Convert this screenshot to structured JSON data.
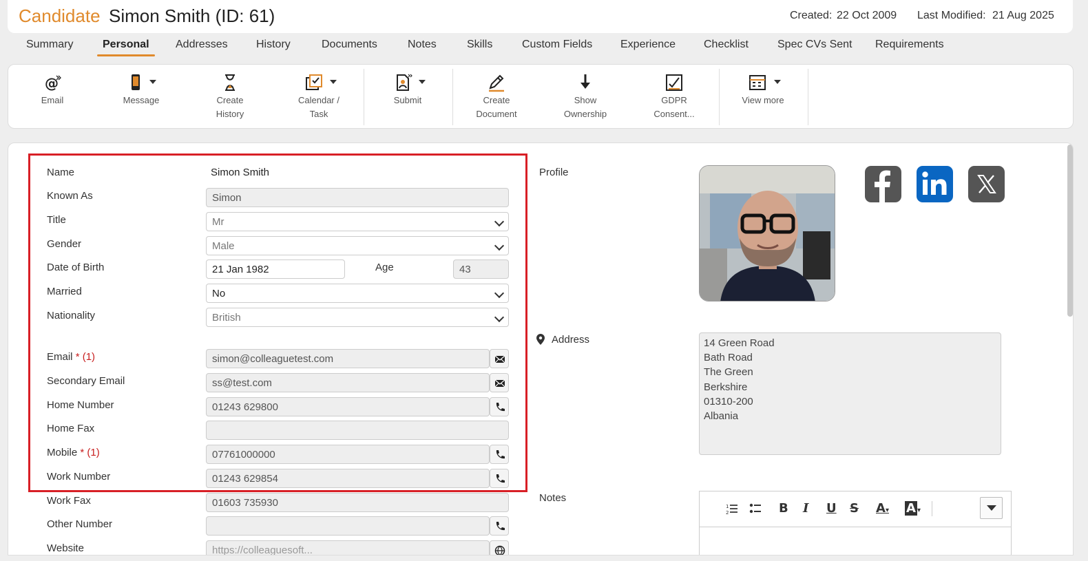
{
  "header": {
    "entity": "Candidate",
    "title": "Simon Smith (ID: 61)",
    "created_label": "Created:",
    "created_value": "22 Oct 2009",
    "modified_label": "Last Modified:",
    "modified_value": "21 Aug 2025"
  },
  "tabs": [
    "Summary",
    "Personal",
    "Addresses",
    "History",
    "Documents",
    "Notes",
    "Skills",
    "Custom Fields",
    "Experience",
    "Checklist",
    "Spec CVs Sent",
    "Requirements"
  ],
  "active_tab": "Personal",
  "toolbar": {
    "email": "Email",
    "message": "Message",
    "create_history_1": "Create",
    "create_history_2": "History",
    "calendar_1": "Calendar /",
    "calendar_2": "Task",
    "submit": "Submit",
    "create_document_1": "Create",
    "create_document_2": "Document",
    "show_ownership_1": "Show",
    "show_ownership_2": "Ownership",
    "gdpr_1": "GDPR",
    "gdpr_2": "Consent...",
    "view_more": "View more"
  },
  "form": {
    "name_label": "Name",
    "name_value": "Simon Smith",
    "known_as_label": "Known As",
    "known_as_value": "Simon",
    "title_label": "Title",
    "title_value": "Mr",
    "gender_label": "Gender",
    "gender_value": "Male",
    "dob_label": "Date of Birth",
    "dob_value": "21 Jan 1982",
    "age_label": "Age",
    "age_value": "43",
    "married_label": "Married",
    "married_value": "No",
    "nationality_label": "Nationality",
    "nationality_value": "British",
    "email_label": "Email",
    "email_req": "* (1)",
    "email_value": "simon@colleaguetest.com",
    "secondary_email_label": "Secondary Email",
    "secondary_email_value": "ss@test.com",
    "home_number_label": "Home Number",
    "home_number_value": "01243 629800",
    "home_fax_label": "Home Fax",
    "home_fax_value": "",
    "mobile_label": "Mobile",
    "mobile_req": "* (1)",
    "mobile_value": "07761000000",
    "work_number_label": "Work Number",
    "work_number_value": "01243 629854",
    "work_fax_label": "Work Fax",
    "work_fax_value": "01603 735930",
    "other_number_label": "Other Number",
    "other_number_value": "",
    "website_label": "Website",
    "website_value": "https://colleaguesoft..."
  },
  "right": {
    "profile_label": "Profile",
    "address_label": "Address",
    "address_lines": [
      "14 Green Road",
      "Bath Road",
      "The Green",
      "Berkshire",
      "01310-200",
      "Albania"
    ],
    "notes_label": "Notes"
  },
  "colors": {
    "accent": "#e08a2c",
    "highlight_box": "#d81f26",
    "required": "#c81e1e",
    "linkedin": "#0a66c2",
    "social_gray": "#555555"
  }
}
